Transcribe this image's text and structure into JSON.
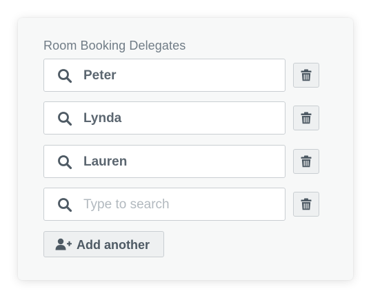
{
  "section": {
    "label": "Room Booking Delegates"
  },
  "delegates": [
    {
      "value": "Peter",
      "placeholder": ""
    },
    {
      "value": "Lynda",
      "placeholder": ""
    },
    {
      "value": "Lauren",
      "placeholder": ""
    },
    {
      "value": "",
      "placeholder": "Type to search"
    }
  ],
  "actions": {
    "add_label": "Add another"
  },
  "icons": {
    "search": "search-icon",
    "remove": "trash-icon",
    "add": "user-plus-icon"
  },
  "colors": {
    "label": "#707c86",
    "value_text": "#5b6670",
    "placeholder_text": "#b2b9bf",
    "border": "#c9ced2",
    "button_bg": "#eef0f1",
    "icon": "#4e5a64"
  }
}
